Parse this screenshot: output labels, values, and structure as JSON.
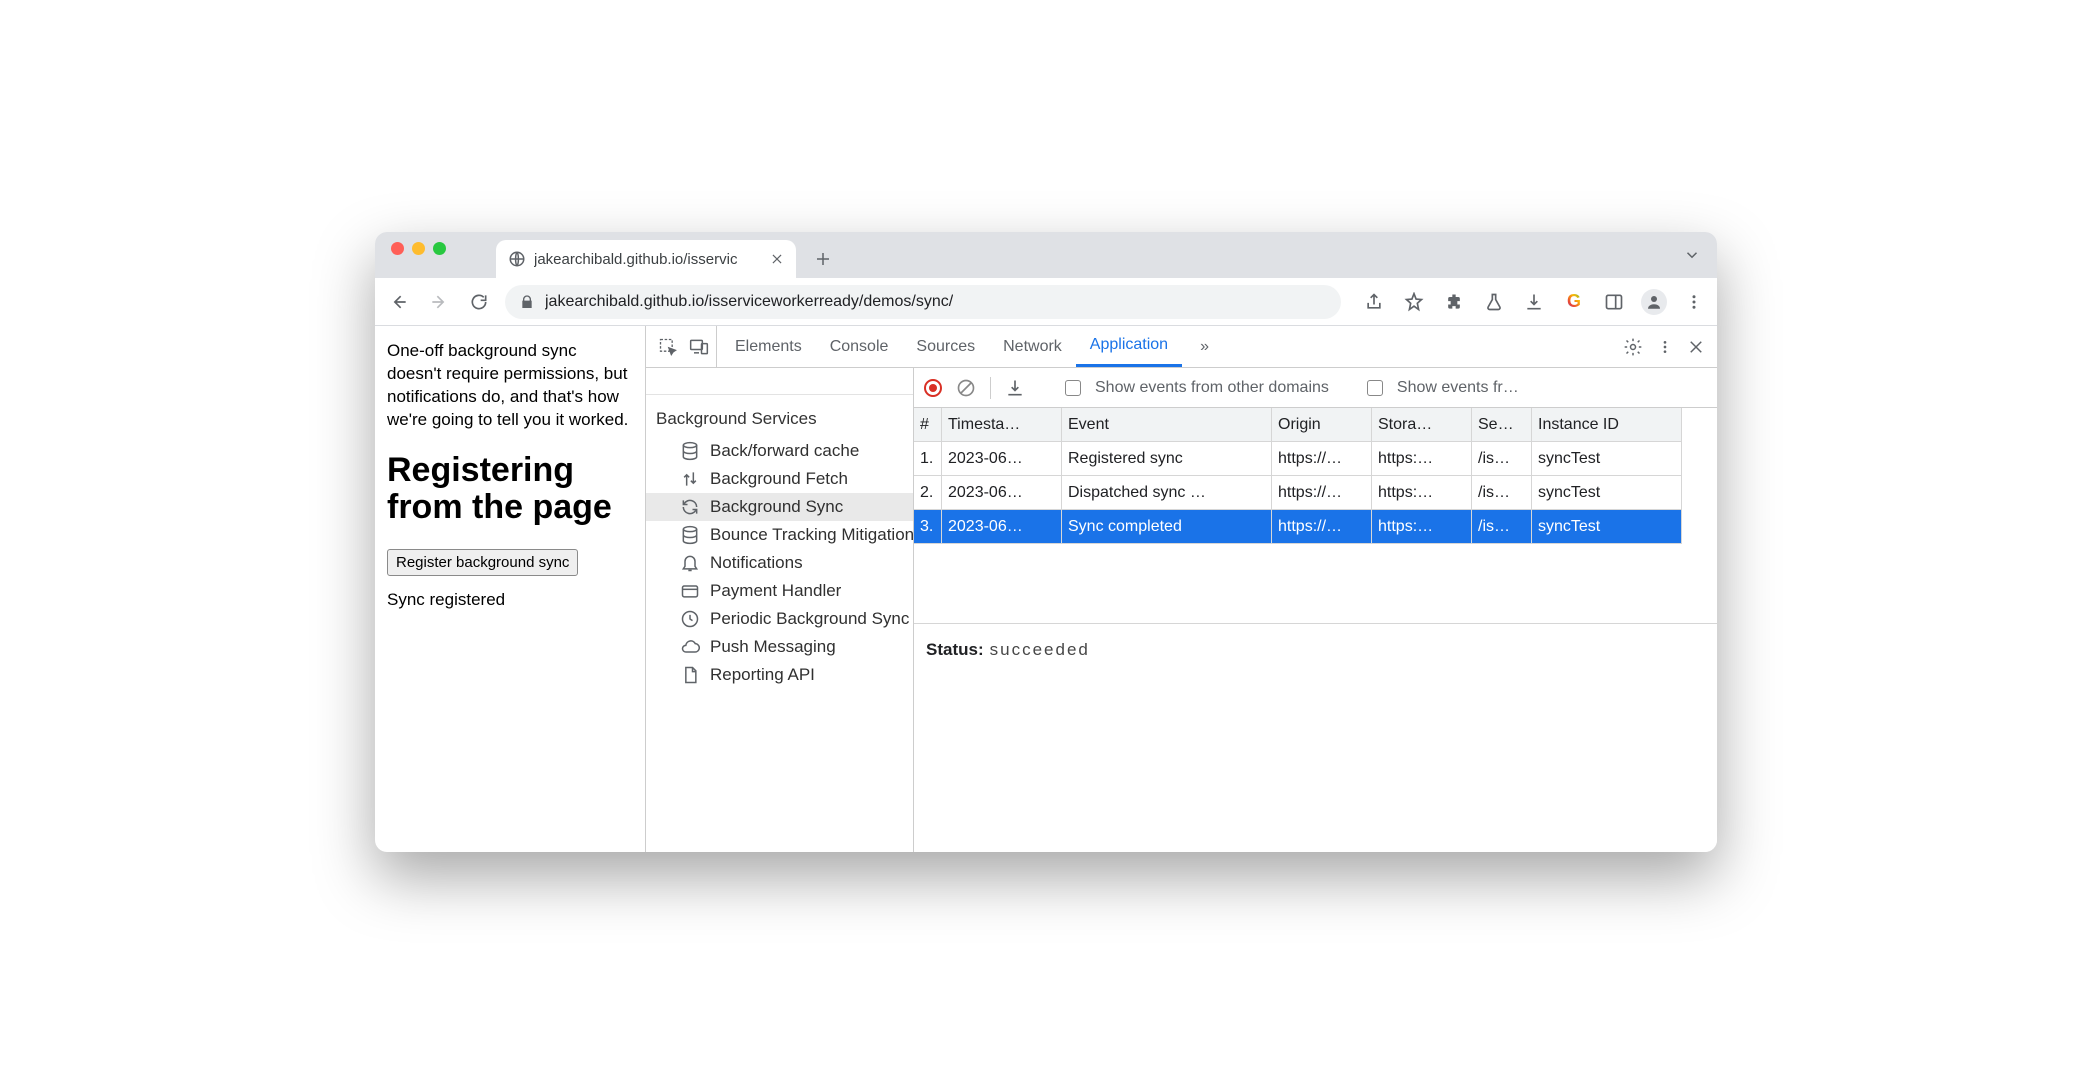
{
  "tab": {
    "title": "jakearchibald.github.io/isservic"
  },
  "url": "jakearchibald.github.io/isserviceworkerready/demos/sync/",
  "page": {
    "intro": "One-off background sync doesn't require permissions, but notifications do, and that's how we're going to tell you it worked.",
    "heading": "Registering from the page",
    "button": "Register background sync",
    "status": "Sync registered"
  },
  "devtools": {
    "tabs": [
      "Elements",
      "Console",
      "Sources",
      "Network",
      "Application"
    ],
    "active_tab": "Application",
    "more": "»",
    "sidebar": {
      "section": "Background Services",
      "items": [
        {
          "label": "Back/forward cache",
          "icon": "db"
        },
        {
          "label": "Background Fetch",
          "icon": "updown"
        },
        {
          "label": "Background Sync",
          "icon": "sync",
          "selected": true
        },
        {
          "label": "Bounce Tracking Mitigation",
          "icon": "db"
        },
        {
          "label": "Notifications",
          "icon": "bell"
        },
        {
          "label": "Payment Handler",
          "icon": "card"
        },
        {
          "label": "Periodic Background Sync",
          "icon": "clock"
        },
        {
          "label": "Push Messaging",
          "icon": "cloud"
        },
        {
          "label": "Reporting API",
          "icon": "file"
        }
      ]
    },
    "toolbar": {
      "show_other": "Show events from other domains",
      "show_fr": "Show events fr…"
    },
    "columns": [
      "#",
      "Timesta…",
      "Event",
      "Origin",
      "Stora…",
      "Se…",
      "Instance ID"
    ],
    "rows": [
      {
        "n": "1.",
        "ts": "2023-06…",
        "event": "Registered sync",
        "origin": "https://…",
        "storage": "https:…",
        "scope": "/is…",
        "instance": "syncTest"
      },
      {
        "n": "2.",
        "ts": "2023-06…",
        "event": "Dispatched sync …",
        "origin": "https://…",
        "storage": "https:…",
        "scope": "/is…",
        "instance": "syncTest"
      },
      {
        "n": "3.",
        "ts": "2023-06…",
        "event": "Sync completed",
        "origin": "https://…",
        "storage": "https:…",
        "scope": "/is…",
        "instance": "syncTest",
        "selected": true
      }
    ],
    "status_label": "Status:",
    "status_value": "succeeded"
  }
}
